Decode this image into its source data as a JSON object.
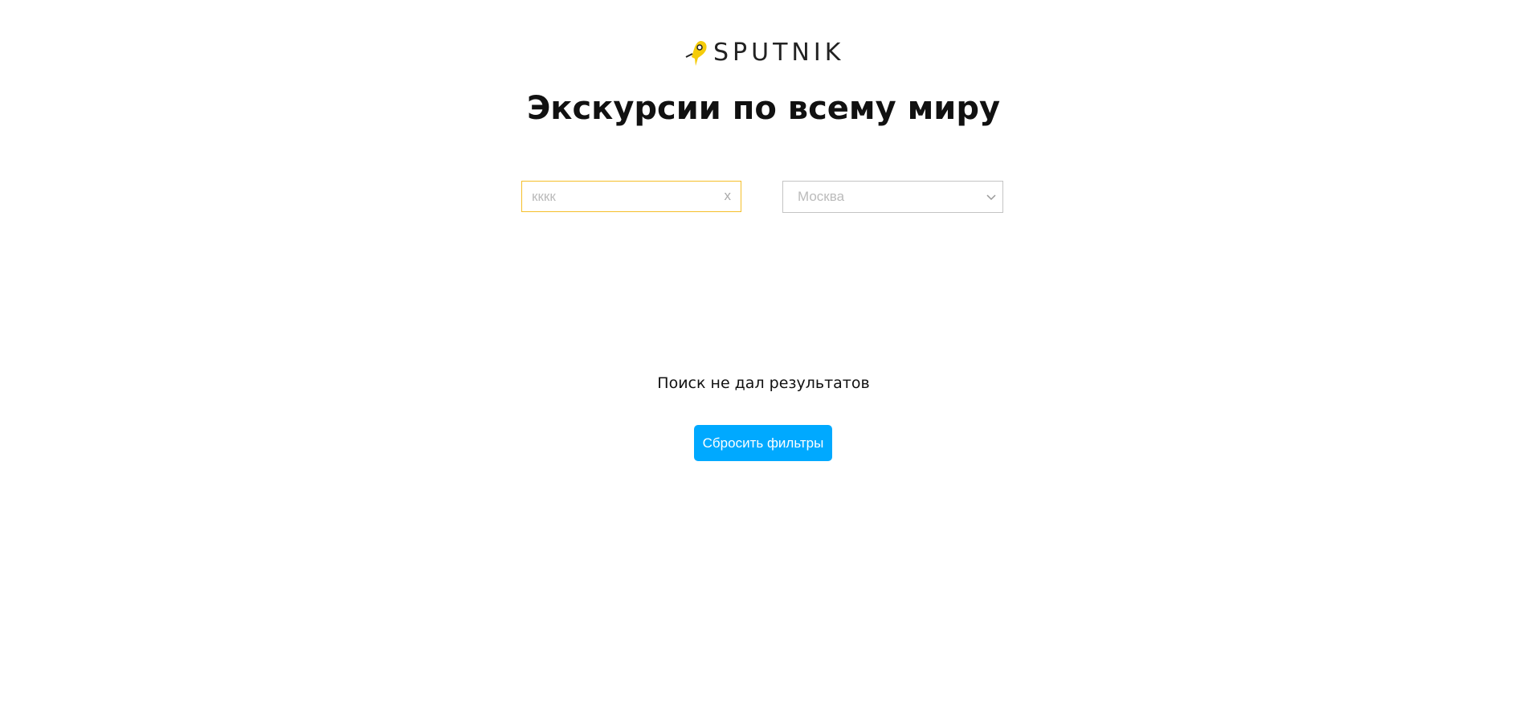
{
  "header": {
    "logo_text": "SPUTNIK",
    "title": "Экскурсии по всему миру"
  },
  "search": {
    "value": "кккк",
    "clear_label": "x"
  },
  "city_select": {
    "selected": "Москва"
  },
  "results": {
    "empty_message": "Поиск не дал результатов",
    "reset_label": "Сбросить фильтры"
  },
  "colors": {
    "accent": "#f5bf2a",
    "button": "#00a9ff"
  }
}
